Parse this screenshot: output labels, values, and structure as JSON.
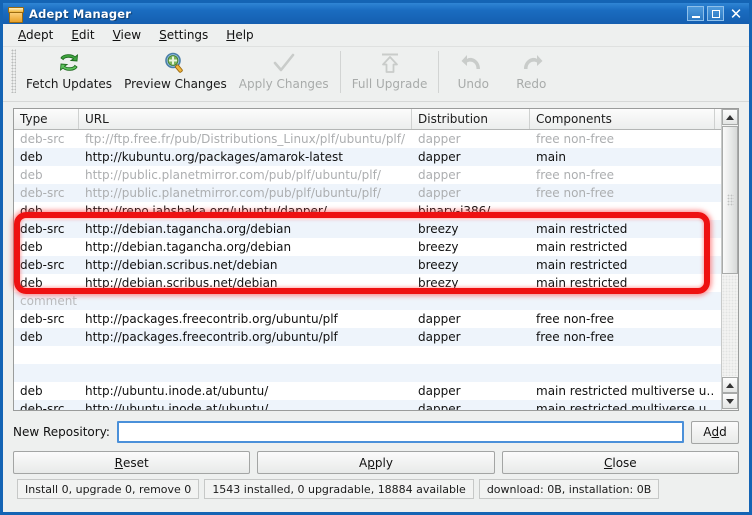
{
  "window": {
    "title": "Adept Manager",
    "app_icon": "package-icon",
    "buttons": {
      "minimize": "minimize-icon",
      "maximize": "maximize-icon",
      "close": "✕"
    }
  },
  "menubar": [
    {
      "label": "Adept",
      "accel": "A"
    },
    {
      "label": "Edit",
      "accel": "E"
    },
    {
      "label": "View",
      "accel": "V"
    },
    {
      "label": "Settings",
      "accel": "S"
    },
    {
      "label": "Help",
      "accel": "H"
    }
  ],
  "toolbar": [
    {
      "label": "Fetch Updates",
      "icon": "refresh-icon",
      "enabled": true
    },
    {
      "label": "Preview Changes",
      "icon": "magnifier-icon",
      "enabled": true
    },
    {
      "label": "Apply Changes",
      "icon": "checkmark-icon",
      "enabled": false
    },
    {
      "label": "Full Upgrade",
      "icon": "upload-arrow-icon",
      "enabled": false
    },
    {
      "label": "Undo",
      "icon": "undo-arrow-icon",
      "enabled": false
    },
    {
      "label": "Redo",
      "icon": "redo-arrow-icon",
      "enabled": false
    }
  ],
  "table": {
    "columns": [
      "Type",
      "URL",
      "Distribution",
      "Components"
    ],
    "rows": [
      {
        "type": "deb-src",
        "url": "ftp://ftp.free.fr/pub/Distributions_Linux/plf/ubuntu/plf/",
        "dist": "dapper",
        "comp": "free non-free",
        "state": "dim"
      },
      {
        "type": "deb",
        "url": "http://kubuntu.org/packages/amarok-latest",
        "dist": "dapper",
        "comp": "main",
        "state": "normal"
      },
      {
        "type": "deb",
        "url": "http://public.planetmirror.com/pub/plf/ubuntu/plf/",
        "dist": "dapper",
        "comp": "free non-free",
        "state": "dim"
      },
      {
        "type": "deb-src",
        "url": "http://public.planetmirror.com/pub/plf/ubuntu/plf/",
        "dist": "dapper",
        "comp": "free non-free",
        "state": "dim"
      },
      {
        "type": "deb",
        "url": "http://repo.jahshaka.org/ubuntu/dapper/",
        "dist": "binary-i386/",
        "comp": "",
        "state": "normal"
      },
      {
        "type": "deb-src",
        "url": "http://debian.tagancha.org/debian",
        "dist": "breezy",
        "comp": "main restricted",
        "state": "normal"
      },
      {
        "type": "deb",
        "url": "http://debian.tagancha.org/debian",
        "dist": "breezy",
        "comp": "main restricted",
        "state": "normal"
      },
      {
        "type": "deb-src",
        "url": "http://debian.scribus.net/debian",
        "dist": "breezy",
        "comp": "main restricted",
        "state": "normal"
      },
      {
        "type": "deb",
        "url": "http://debian.scribus.net/debian",
        "dist": "breezy",
        "comp": "main restricted",
        "state": "normal"
      },
      {
        "type": "comment #",
        "url": "",
        "dist": "",
        "comp": "",
        "state": "comment"
      },
      {
        "type": "deb-src",
        "url": "http://packages.freecontrib.org/ubuntu/plf",
        "dist": "dapper",
        "comp": "free non-free",
        "state": "normal"
      },
      {
        "type": "deb",
        "url": "http://packages.freecontrib.org/ubuntu/plf",
        "dist": "dapper",
        "comp": "free non-free",
        "state": "normal"
      },
      {
        "type": "",
        "url": "",
        "dist": "",
        "comp": "",
        "state": "blank"
      },
      {
        "type": "",
        "url": "",
        "dist": "",
        "comp": "",
        "state": "blank"
      },
      {
        "type": "deb",
        "url": "http://ubuntu.inode.at/ubuntu/",
        "dist": "dapper",
        "comp": "main restricted multiverse u…",
        "state": "normal"
      },
      {
        "type": "deb-src",
        "url": "http://ubuntu.inode.at/ubuntu/",
        "dist": "dapper",
        "comp": "main restricted multiverse u…",
        "state": "normal"
      },
      {
        "type": "",
        "url": "",
        "dist": "",
        "comp": "",
        "state": "blank"
      }
    ],
    "highlight": {
      "color": "#ee1111",
      "first_row_index": 5,
      "last_row_index": 8
    }
  },
  "new_repository": {
    "label": "New Repository:",
    "value": "",
    "placeholder": "",
    "add_label": "Add",
    "add_accel": "d"
  },
  "action_buttons": [
    {
      "label": "Reset",
      "accel": "R"
    },
    {
      "label": "Apply",
      "accel": "p"
    },
    {
      "label": "Close",
      "accel": "C"
    }
  ],
  "statusbar": [
    "Install 0, upgrade 0, remove 0",
    "1543 installed, 0 upgradable, 18884 available",
    "download: 0B, installation: 0B"
  ]
}
